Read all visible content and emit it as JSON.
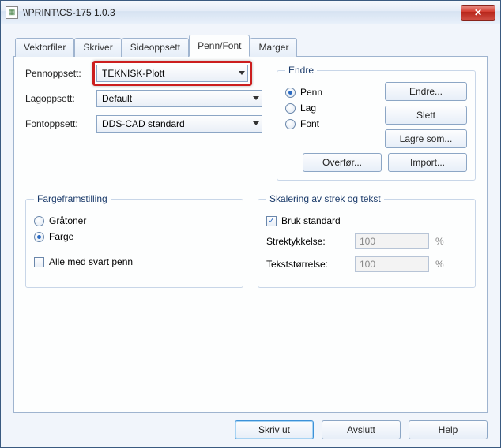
{
  "window": {
    "title": "\\\\PRINT\\CS-175 1.0.3"
  },
  "tabs": {
    "vektorfiler": "Vektorfiler",
    "skriver": "Skriver",
    "sideoppsett": "Sideoppsett",
    "pennfont": "Penn/Font",
    "marger": "Marger"
  },
  "form": {
    "pennoppsett_label": "Pennoppsett:",
    "pennoppsett_value": "TEKNISK-Plott",
    "lagoppsett_label": "Lagoppsett:",
    "lagoppsett_value": "Default",
    "fontoppsett_label": "Fontoppsett:",
    "fontoppsett_value": "DDS-CAD standard"
  },
  "endre": {
    "legend": "Endre",
    "penn": "Penn",
    "lag": "Lag",
    "font": "Font",
    "btn_endre": "Endre...",
    "btn_slett": "Slett",
    "btn_lagresom": "Lagre som...",
    "btn_overfor": "Overfør...",
    "btn_import": "Import..."
  },
  "farge": {
    "legend": "Fargeframstilling",
    "gratoner": "Gråtoner",
    "farge": "Farge",
    "alle_svart": "Alle med svart penn"
  },
  "skalering": {
    "legend": "Skalering av strek og tekst",
    "bruk_standard": "Bruk standard",
    "strektykkelse": "Strektykkelse:",
    "strektykkelse_val": "100",
    "tekststorrelse": "Tekststørrelse:",
    "tekststorrelse_val": "100",
    "pct": "%"
  },
  "buttons": {
    "skrivut": "Skriv ut",
    "avslutt": "Avslutt",
    "help": "Help"
  }
}
